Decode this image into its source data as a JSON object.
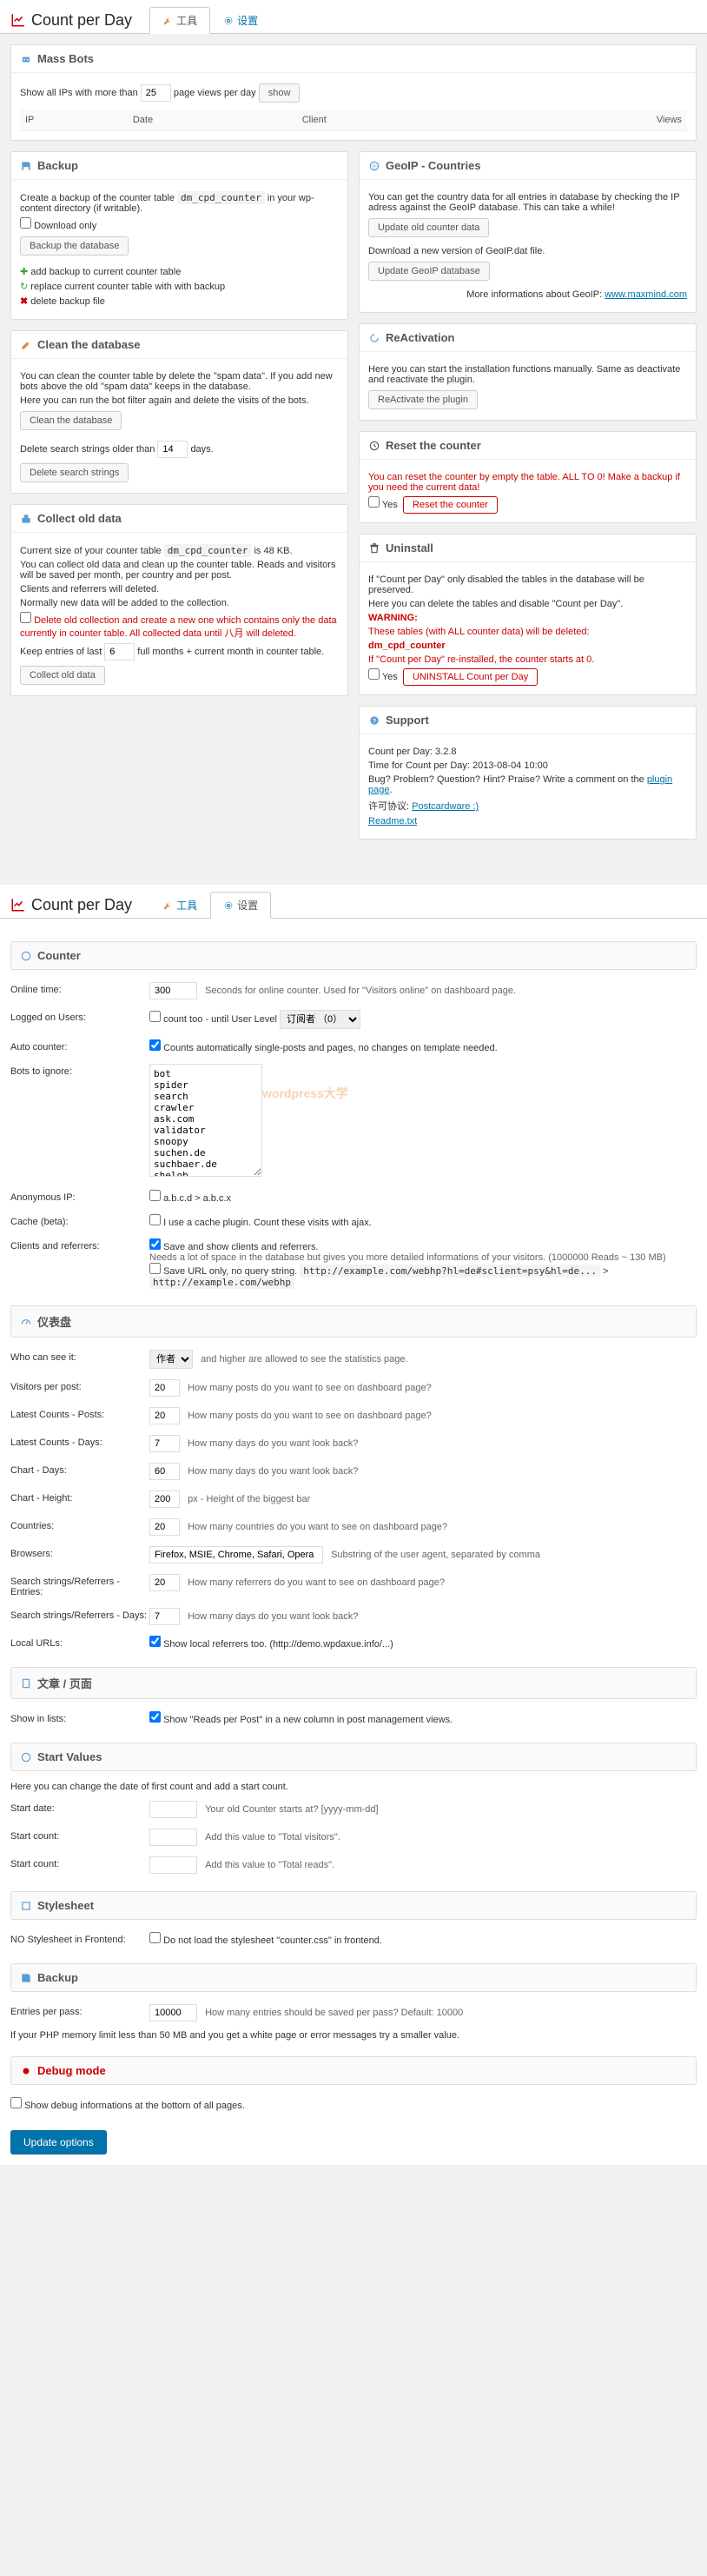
{
  "app_title": "Count per Day",
  "tabs": {
    "tools": "工具",
    "settings": "设置"
  },
  "massbots": {
    "title": "Mass Bots",
    "line_pre": "Show all IPs with more than",
    "value": "25",
    "line_post": "page views per day",
    "show_btn": "show",
    "th_ip": "IP",
    "th_date": "Date",
    "th_client": "Client",
    "th_views": "Views"
  },
  "backup": {
    "title": "Backup",
    "desc_pre": "Create a backup of the counter table",
    "desc_code": "dm_cpd_counter",
    "desc_post": "in your wp-content directory (if writable).",
    "dl_only": "Download only",
    "btn": "Backup the database",
    "add": "add backup to current counter table",
    "replace": "replace current counter table with with backup",
    "delete": "delete backup file"
  },
  "clean": {
    "title": "Clean the database",
    "p1": "You can clean the counter table by delete the \"spam data\". If you add new bots above the old \"spam data\" keeps in the database.",
    "p2": "Here you can run the bot filter again and delete the visits of the bots.",
    "btn1": "Clean the database",
    "p3_pre": "Delete search strings older than",
    "p3_val": "14",
    "p3_post": "days.",
    "btn2": "Delete search strings"
  },
  "collect": {
    "title": "Collect old data",
    "p1_pre": "Current size of your counter table",
    "p1_code": "dm_cpd_counter",
    "p1_post": "is 48 KB.",
    "p2": "You can collect old data and clean up the counter table. Reads and visitors will be saved per month, per country and per post.",
    "p3": "Clients and referrers will deleted.",
    "p4": "Normally new data will be added to the collection.",
    "chk": "Delete old collection and create a new one which contains only the data currently in counter table. All collected data until 八月 will deleted.",
    "keep_pre": "Keep entries of last",
    "keep_val": "6",
    "keep_post": "full months + current month in counter table.",
    "btn": "Collect old data"
  },
  "geoip": {
    "title": "GeoIP - Countries",
    "p1": "You can get the country data for all entries in database by checking the IP adress against the GeoIP database. This can take a while!",
    "btn1": "Update old counter data",
    "p2": "Download a new version of GeoIP.dat file.",
    "btn2": "Update GeoIP database",
    "more": "More informations about GeoIP:",
    "link": "www.maxmind.com"
  },
  "react": {
    "title": "ReActivation",
    "p1": "Here you can start the installation functions manually. Same as deactivate and reactivate the plugin.",
    "btn": "ReActivate the plugin"
  },
  "reset": {
    "title": "Reset the counter",
    "p1": "You can reset the counter by empty the table. ALL TO 0! Make a backup if you need the current data!",
    "yes": "Yes",
    "btn": "Reset the counter"
  },
  "uninstall": {
    "title": "Uninstall",
    "p1": "If \"Count per Day\" only disabled the tables in the database will be preserved.",
    "p2": "Here you can delete the tables and disable \"Count per Day\".",
    "warn": "WARNING:",
    "p3": "These tables (with ALL counter data) will be deleted:",
    "code": "dm_cpd_counter",
    "p4": "If \"Count per Day\" re-installed, the counter starts at 0.",
    "yes": "Yes",
    "btn": "UNINSTALL Count per Day"
  },
  "support": {
    "title": "Support",
    "ver_label": "Count per Day:",
    "ver": "3.2.8",
    "time_label": "Time for Count per Day:",
    "time": "2013-08-04 10:00",
    "bug": "Bug? Problem? Question? Hint? Praise? Write a comment on the",
    "bug_link": "plugin page",
    "license": "许可协议:",
    "license_link": "Postcardware :)",
    "readme": "Readme.txt"
  },
  "counter": {
    "title": "Counter",
    "online_label": "Online time:",
    "online_val": "300",
    "online_hint": "Seconds for online counter. Used for \"Visitors online\" on dashboard page.",
    "logged_label": "Logged on Users:",
    "logged_chk": "count too - until User Level",
    "logged_select": "订阅者 （0）",
    "auto_label": "Auto counter:",
    "auto_hint": "Counts automatically single-posts and pages, no changes on template needed.",
    "bots_label": "Bots to ignore:",
    "bots_val": "bot\nspider\nsearch\ncrawler\nask.com\nvalidator\nsnoopy\nsuchen.de\nsuchbaer.de\nshelob",
    "anon_label": "Anonymous IP:",
    "anon_hint": "a.b.c.d > a.b.c.x",
    "cache_label": "Cache (beta):",
    "cache_hint": "I use a cache plugin. Count these visits with ajax.",
    "clients_label": "Clients and referrers:",
    "clients_chk": "Save and show clients and referrers.",
    "clients_hint": "Needs a lot of space in the database but gives you more detailed informations of your visitors. (1000000 Reads ~ 130 MB)",
    "clients_url_chk": "Save URL only, no query string.",
    "url1": "http://example.com/webhp?hl=de#sclient=psy&hl=de...",
    "arrow": ">",
    "url2": "http://example.com/webhp"
  },
  "dashboard": {
    "title": "仪表盘",
    "who_label": "Who can see it:",
    "who_select": "作者",
    "who_hint": "and higher are allowed to see the statistics page.",
    "vpp_label": "Visitors per post:",
    "vpp_val": "20",
    "vpp_hint": "How many posts do you want to see on dashboard page?",
    "lcp_label": "Latest Counts - Posts:",
    "lcp_val": "20",
    "lcp_hint": "How many posts do you want to see on dashboard page?",
    "lcd_label": "Latest Counts - Days:",
    "lcd_val": "7",
    "lcd_hint": "How many days do you want look back?",
    "cd_label": "Chart - Days:",
    "cd_val": "60",
    "cd_hint": "How many days do you want look back?",
    "ch_label": "Chart - Height:",
    "ch_val": "200",
    "ch_hint": "px - Height of the biggest bar",
    "co_label": "Countries:",
    "co_val": "20",
    "co_hint": "How many countries do you want to see on dashboard page?",
    "br_label": "Browsers:",
    "br_val": "Firefox, MSIE, Chrome, Safari, Opera",
    "br_hint": "Substring of the user agent, separated by comma",
    "sre_label": "Search strings/Referrers - Entries:",
    "sre_val": "20",
    "sre_hint": "How many referrers do you want to see on dashboard page?",
    "srd_label": "Search strings/Referrers - Days:",
    "srd_val": "7",
    "srd_hint": "How many days do you want look back?",
    "lu_label": "Local URLs:",
    "lu_hint": "Show local referrers too. (http://demo.wpdaxue.info/...)"
  },
  "posts": {
    "title": "文章 / 页面",
    "sl_label": "Show in lists:",
    "sl_hint": "Show \"Reads per Post\" in a new column in post management views."
  },
  "startvals": {
    "title": "Start Values",
    "intro": "Here you can change the date of first count and add a start count.",
    "sd_label": "Start date:",
    "sd_hint": "Your old Counter starts at? [yyyy-mm-dd]",
    "sc_label": "Start count:",
    "sc_hint": "Add this value to \"Total visitors\".",
    "sr_label": "Start count:",
    "sr_hint": "Add this value to \"Total reads\"."
  },
  "stylesheet": {
    "title": "Stylesheet",
    "label": "NO Stylesheet in Frontend:",
    "hint": "Do not load the stylesheet \"counter.css\" in frontend."
  },
  "backup2": {
    "title": "Backup",
    "label": "Entries per pass:",
    "val": "10000",
    "hint": "How many entries should be saved per pass? Default: 10000",
    "note": "If your PHP memory limit less than 50 MB and you get a white page or error messages try a smaller value."
  },
  "debug": {
    "title": "Debug mode",
    "hint": "Show debug informations at the bottom of all pages."
  },
  "submit": "Update options",
  "watermark": "wordpress大学"
}
